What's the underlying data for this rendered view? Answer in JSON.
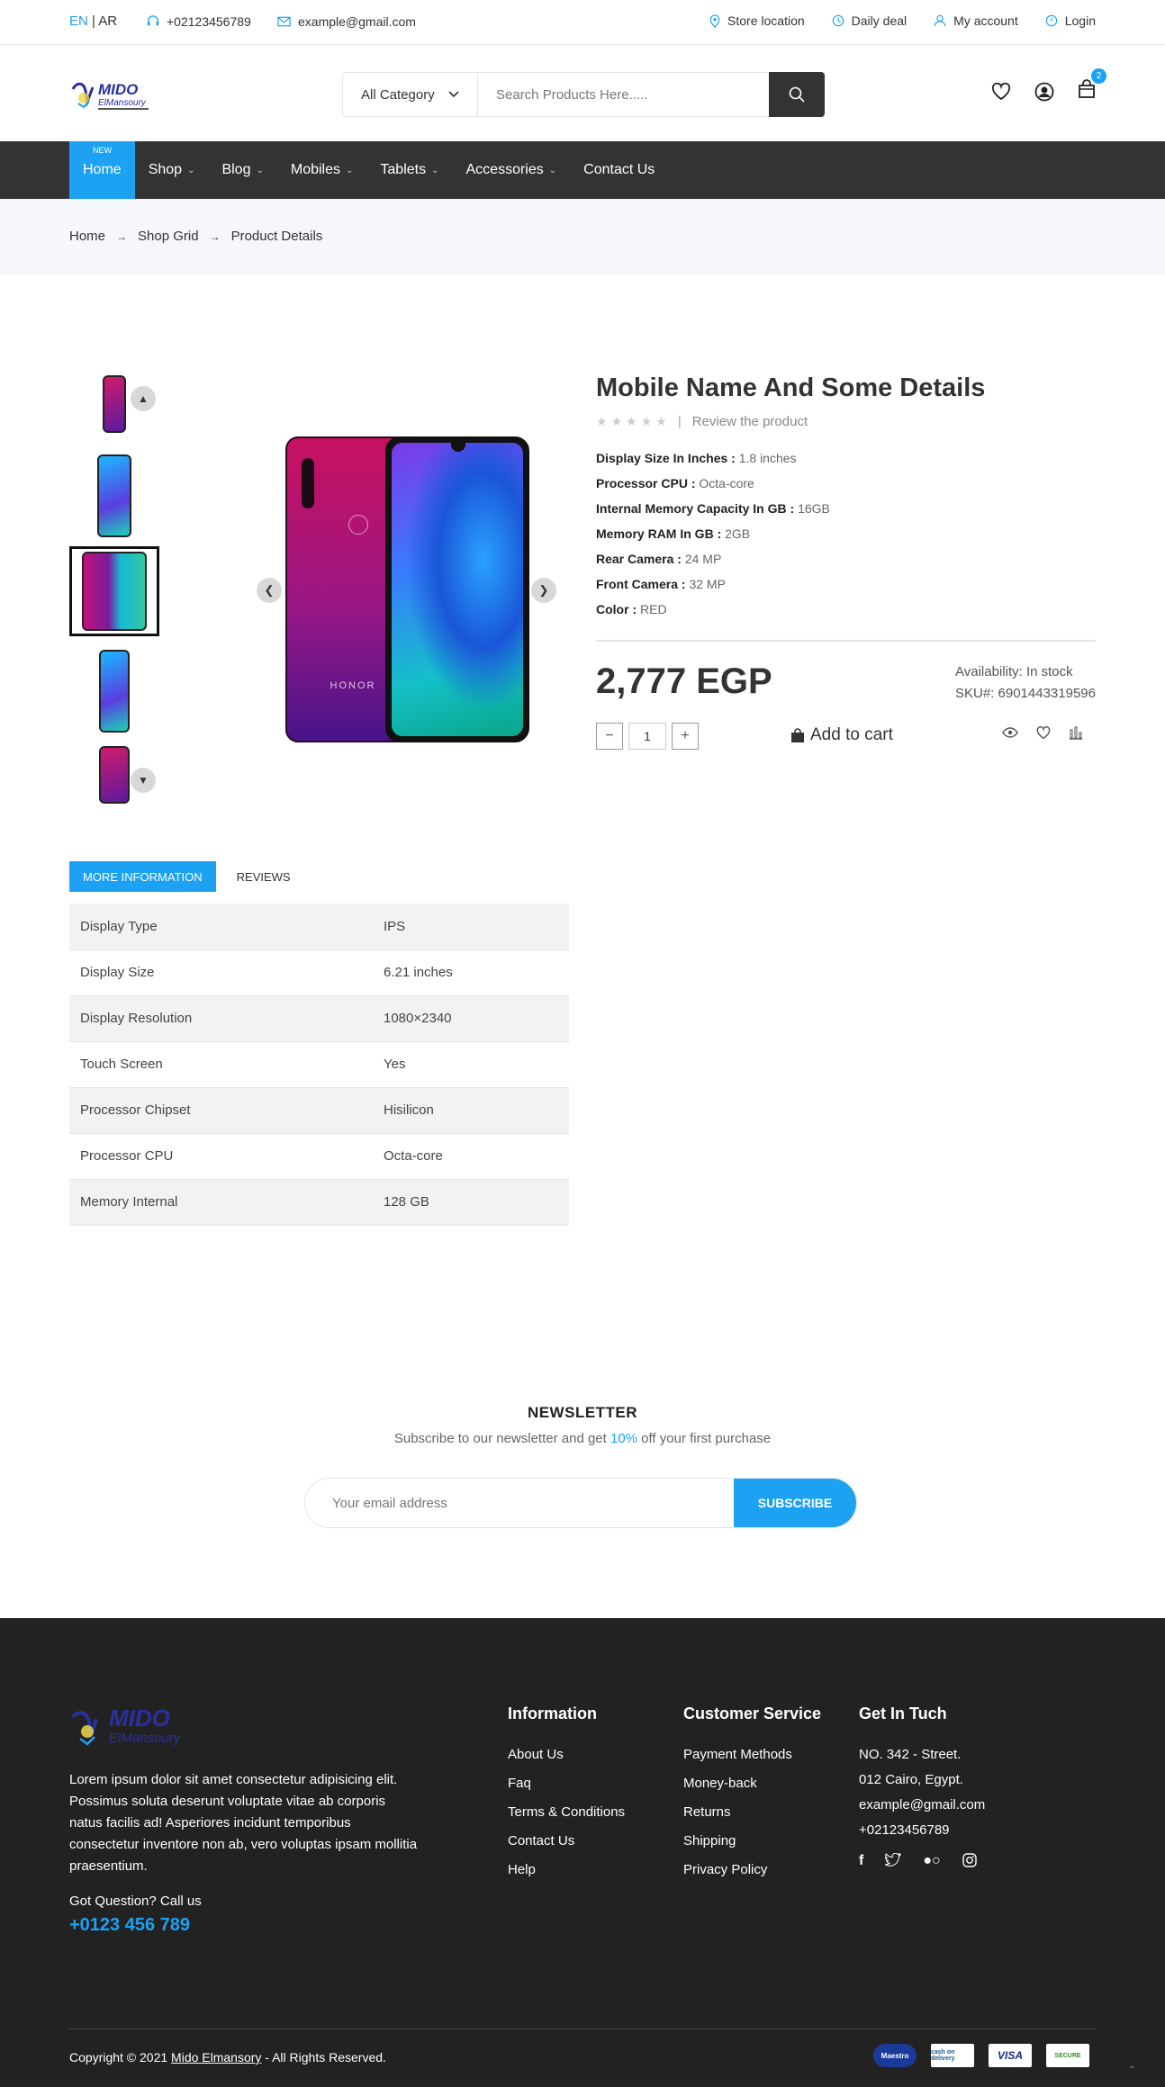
{
  "topbar": {
    "lang_en": "EN",
    "lang_sep": " | ",
    "lang_ar": "AR",
    "phone": "+02123456789",
    "email": "example@gmail.com",
    "store_location": "Store location",
    "daily_deal": "Daily deal",
    "my_account": "My account",
    "login": "Login"
  },
  "header": {
    "category": "All Category",
    "search_placeholder": "Search Products Here.....",
    "cart_count": "2",
    "logo_text": "MIDO",
    "logo_sub": "ElMansoury"
  },
  "nav": {
    "items": [
      {
        "label": "Home"
      },
      {
        "label": "Shop",
        "badge": "NEW"
      },
      {
        "label": "Blog"
      },
      {
        "label": "Mobiles"
      },
      {
        "label": "Tablets"
      },
      {
        "label": "Accessories"
      },
      {
        "label": "Contact Us"
      }
    ]
  },
  "breadcrumb": [
    "Home",
    "Shop Grid",
    "Product Details"
  ],
  "product": {
    "title": "Mobile Name And Some Details",
    "review_link": "Review the product",
    "brand": "HONOR",
    "specs": [
      {
        "k": "Display Size In Inches :",
        "v": "1.8 inches"
      },
      {
        "k": "Processor CPU :",
        "v": "Octa-core"
      },
      {
        "k": "Internal Memory Capacity In GB :",
        "v": "16GB"
      },
      {
        "k": "Memory RAM In GB :",
        "v": "2GB"
      },
      {
        "k": "Rear Camera :",
        "v": "24 MP"
      },
      {
        "k": "Front Camera :",
        "v": "32 MP"
      },
      {
        "k": "Color :",
        "v": "RED"
      }
    ],
    "price": "2,777 EGP",
    "availability": "Availability: In stock",
    "sku": "SKU#: 6901443319596",
    "quantity": "1",
    "add_to_cart": "Add to cart"
  },
  "tabs": {
    "more_info": "MORE INFORMATION",
    "reviews": "REVIEWS"
  },
  "info_table": [
    {
      "k": "Display Type",
      "v": "IPS"
    },
    {
      "k": "Display Size",
      "v": "6.21 inches"
    },
    {
      "k": "Display Resolution",
      "v": "1080×2340"
    },
    {
      "k": "Touch Screen",
      "v": "Yes"
    },
    {
      "k": "Processor Chipset",
      "v": "Hisilicon"
    },
    {
      "k": "Processor CPU",
      "v": "Octa-core"
    },
    {
      "k": "Memory Internal",
      "v": "128 GB"
    }
  ],
  "newsletter": {
    "title": "NEWSLETTER",
    "text_before": "Subscribe to our newsletter and get ",
    "percent": "10%",
    "text_after": " off your first purchase",
    "placeholder": "Your email address",
    "button": "SUBSCRIBE"
  },
  "footer": {
    "description": "Lorem ipsum dolor sit amet consectetur adipisicing elit. Possimus soluta deserunt voluptate vitae ab corporis natus facilis ad! Asperiores incidunt temporibus consectetur inventore non ab, vero voluptas ipsam mollitia praesentium.",
    "question": "Got Question? Call us",
    "phone": "+0123 456 789",
    "info_title": "Information",
    "info_links": [
      "About Us",
      "Faq",
      "Terms & Conditions",
      "Contact Us",
      "Help"
    ],
    "service_title": "Customer Service",
    "service_links": [
      "Payment Methods",
      "Money-back",
      "Returns",
      "Shipping",
      "Privacy Policy"
    ],
    "contact_title": "Get In Tuch",
    "contact_lines": [
      "NO. 342 - Street.",
      "012 Cairo, Egypt.",
      "example@gmail.com",
      "+02123456789"
    ],
    "copyright_before": "Copyright © 2021 ",
    "copyright_link": "Mido Elmansory",
    "copyright_after": " - All Rights Reserved.",
    "payments": [
      "Maestro",
      "cash on delivery",
      "VISA",
      "SECURE"
    ]
  },
  "colors": {
    "accent": "#1da1f2",
    "dark": "#333333",
    "footer_bg": "#222222"
  }
}
